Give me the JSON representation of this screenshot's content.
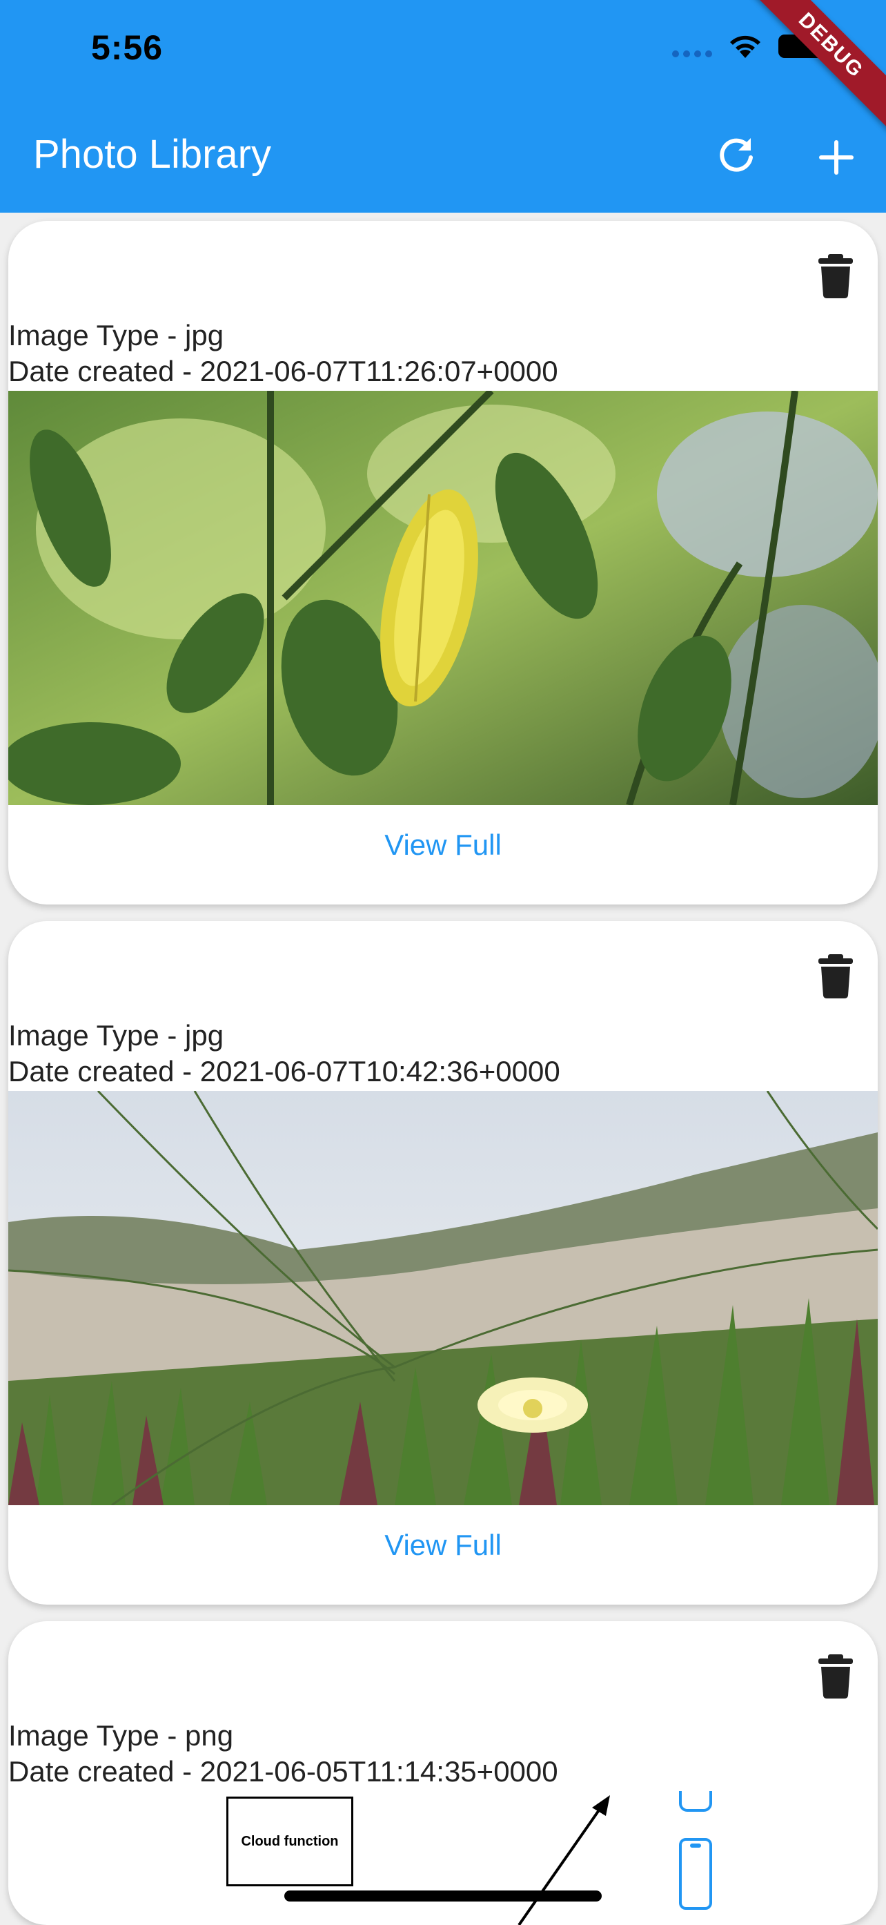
{
  "status_bar": {
    "time": "5:56"
  },
  "debug_banner": "DEBUG",
  "app_bar": {
    "title": "Photo Library",
    "actions": [
      {
        "icon": "refresh-icon"
      },
      {
        "icon": "add-icon"
      }
    ]
  },
  "photos": [
    {
      "type_label": "Image Type - jpg",
      "date_label": "Date created - 2021-06-07T11:26:07+0000",
      "action_label": "View Full"
    },
    {
      "type_label": "Image Type - jpg",
      "date_label": "Date created - 2021-06-07T10:42:36+0000",
      "action_label": "View Full"
    },
    {
      "type_label": "Image Type - png",
      "date_label": "Date created - 2021-06-05T11:14:35+0000",
      "diagram_label": "Cloud function"
    }
  ],
  "colors": {
    "primary": "#2196f3",
    "debug": "#a01a29"
  }
}
